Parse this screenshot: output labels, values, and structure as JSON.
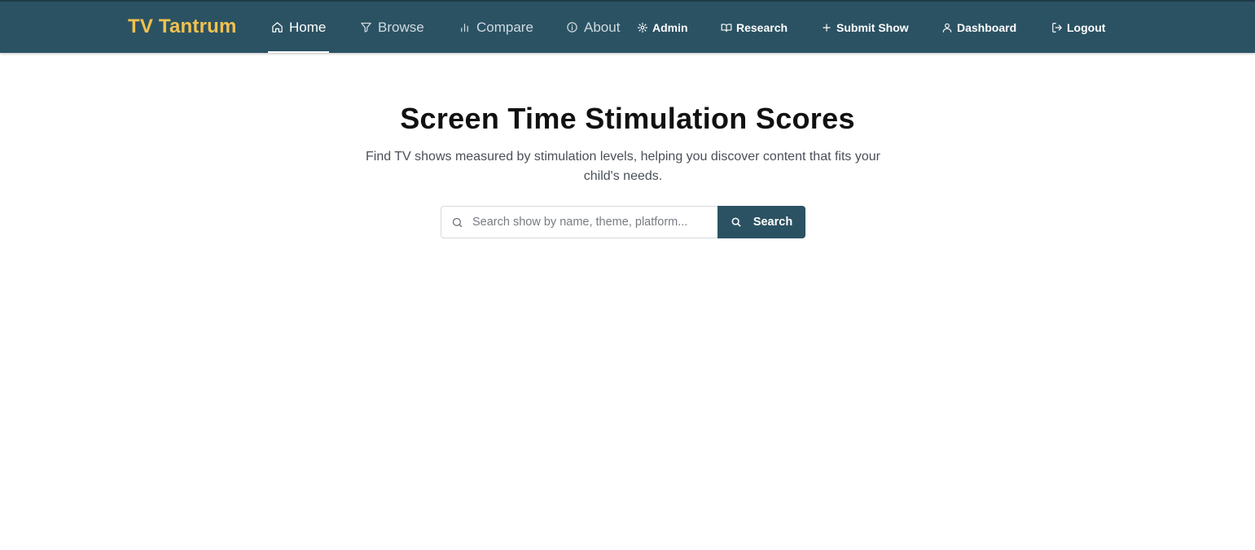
{
  "brand": {
    "name": "TV Tantrum",
    "color": "#f2c14e"
  },
  "theme": {
    "navbar_bg": "#2b5263",
    "primary": "#2b5263"
  },
  "nav": {
    "home": {
      "label": "Home",
      "icon": "home-icon",
      "active": true
    },
    "browse": {
      "label": "Browse",
      "icon": "filter-icon"
    },
    "compare": {
      "label": "Compare",
      "icon": "bar-chart-icon"
    },
    "about": {
      "label": "About",
      "icon": "info-icon"
    },
    "admin": {
      "label": "Admin",
      "icon": "gear-icon"
    },
    "research": {
      "label": "Research",
      "icon": "book-icon"
    },
    "submit": {
      "label": "Submit Show",
      "icon": "plus-icon"
    },
    "dashboard": {
      "label": "Dashboard",
      "icon": "user-icon"
    },
    "logout": {
      "label": "Logout",
      "icon": "logout-icon"
    }
  },
  "hero": {
    "title": "Screen Time Stimulation Scores",
    "subtitle": "Find TV shows measured by stimulation levels, helping you discover content that fits your child's needs."
  },
  "search": {
    "placeholder": "Search show by name, theme, platform...",
    "value": "",
    "button_label": "Search"
  }
}
